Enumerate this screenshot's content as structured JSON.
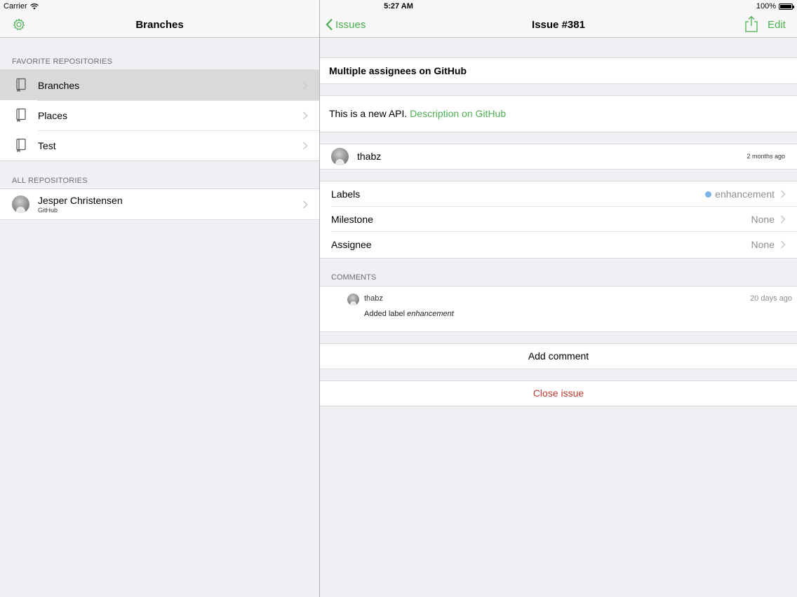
{
  "status_bar": {
    "carrier": "Carrier",
    "time": "5:27 AM",
    "battery": "100%"
  },
  "left": {
    "nav_title": "Branches",
    "favorites_header": "FAVORITE REPOSITORIES",
    "favorites": [
      {
        "label": "Branches",
        "selected": true
      },
      {
        "label": "Places",
        "selected": false
      },
      {
        "label": "Test",
        "selected": false
      }
    ],
    "all_header": "ALL REPOSITORIES",
    "account": {
      "name": "Jesper Christensen",
      "service": "GitHub"
    }
  },
  "right": {
    "back_label": "Issues",
    "nav_title": "Issue #381",
    "edit_label": "Edit",
    "issue_title": "Multiple assignees on GitHub",
    "description_text": "This is a new API.",
    "description_link": "Description on GitHub",
    "author": {
      "name": "thabz",
      "time": "2 months ago"
    },
    "properties": {
      "labels_key": "Labels",
      "labels_value": "enhancement",
      "milestone_key": "Milestone",
      "milestone_value": "None",
      "assignee_key": "Assignee",
      "assignee_value": "None"
    },
    "comments_header": "COMMENTS",
    "comment": {
      "author": "thabz",
      "time": "20 days ago",
      "prefix": "Added label",
      "label": "enhancement"
    },
    "add_comment": "Add comment",
    "close_issue": "Close issue"
  },
  "colors": {
    "accent": "#4caf50",
    "danger": "#c0392b",
    "label_dot": "#7bb3e6"
  }
}
